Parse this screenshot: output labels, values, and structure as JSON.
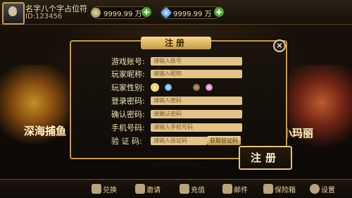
{
  "player": {
    "name": "名字八个字占位符",
    "id": "ID:123456"
  },
  "currencies": [
    {
      "name": "coin",
      "amount": "9999.99 万",
      "color": "#bfa46a"
    },
    {
      "name": "diamond",
      "amount": "9999.99 万",
      "color": "#5fb3ff"
    }
  ],
  "games": {
    "left": "深海捕鱼",
    "right": "小玛丽"
  },
  "dialog": {
    "title": "注册",
    "fields": [
      {
        "label": "游戏账号:",
        "placeholder": "请输入账号"
      },
      {
        "label": "玩家昵称:",
        "placeholder": "请输入昵称"
      },
      {
        "label": "玩家性别:"
      },
      {
        "label": "登录密码:",
        "placeholder": "请输入密码"
      },
      {
        "label": "确认密码:",
        "placeholder": "请确认密码"
      },
      {
        "label": "手机号码:",
        "placeholder": "请输入手机号码"
      },
      {
        "label": "验 证 码:",
        "placeholder": "请输入验证码"
      }
    ],
    "get_code": "获取验证码",
    "register": "注册"
  },
  "bottom_menu": [
    {
      "label": "兑换",
      "icon": "exchange-icon"
    },
    {
      "label": "邀请",
      "icon": "invite-icon"
    },
    {
      "label": "充值",
      "icon": "recharge-icon"
    },
    {
      "label": "邮件",
      "icon": "mail-icon"
    },
    {
      "label": "保险箱",
      "icon": "safe-icon"
    },
    {
      "label": "设置",
      "icon": "gear-icon"
    }
  ]
}
